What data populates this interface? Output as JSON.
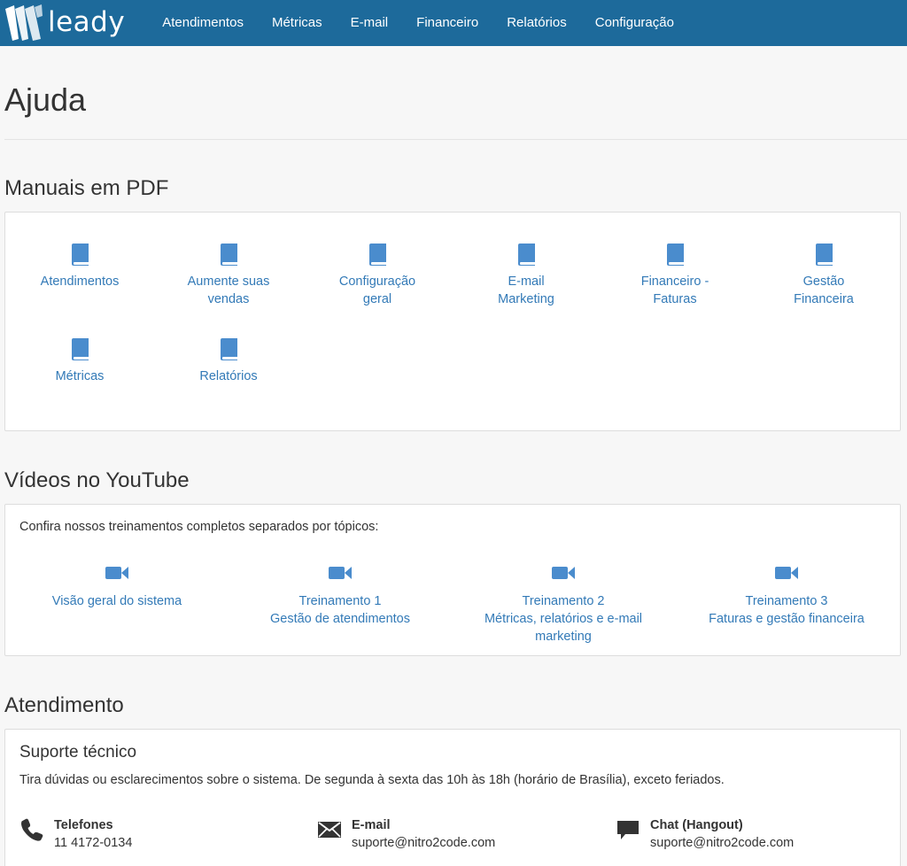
{
  "navbar": {
    "brand": "leady",
    "items": [
      "Atendimentos",
      "Métricas",
      "E-mail",
      "Financeiro",
      "Relatórios",
      "Configuração"
    ]
  },
  "page": {
    "title": "Ajuda"
  },
  "manuals": {
    "title": "Manuais em PDF",
    "items": [
      {
        "line1": "Atendimentos",
        "line2": ""
      },
      {
        "line1": "Aumente suas",
        "line2": "vendas"
      },
      {
        "line1": "Configuração",
        "line2": "geral"
      },
      {
        "line1": "E-mail",
        "line2": "Marketing"
      },
      {
        "line1": "Financeiro -",
        "line2": "Faturas"
      },
      {
        "line1": "Gestão",
        "line2": "Financeira"
      },
      {
        "line1": "Métricas",
        "line2": ""
      },
      {
        "line1": "Relatórios",
        "line2": ""
      }
    ]
  },
  "videos": {
    "title": "Vídeos no YouTube",
    "intro": "Confira nossos treinamentos completos separados por tópicos:",
    "items": [
      {
        "line1": "Visão geral do sistema",
        "line2": "",
        "line3": ""
      },
      {
        "line1": "Treinamento 1",
        "line2": "Gestão de atendimentos",
        "line3": ""
      },
      {
        "line1": "Treinamento 2",
        "line2": "Métricas, relatórios e e-mail",
        "line3": "marketing"
      },
      {
        "line1": "Treinamento 3",
        "line2": "Faturas e gestão financeira",
        "line3": ""
      }
    ]
  },
  "support": {
    "title": "Atendimento",
    "subtitle": "Suporte técnico",
    "description": "Tira dúvidas ou esclarecimentos sobre o sistema. De segunda à sexta das 10h às 18h (horário de Brasília), exceto feriados.",
    "contacts": [
      {
        "label": "Telefones",
        "value": "11 4172-0134",
        "icon": "phone-icon"
      },
      {
        "label": "E-mail",
        "value": "suporte@nitro2code.com",
        "icon": "envelope-icon"
      },
      {
        "label": "Chat (Hangout)",
        "value": "suporte@nitro2code.com",
        "icon": "chat-icon"
      }
    ]
  },
  "colors": {
    "navbar": "#1d6a9b",
    "link": "#337ab7",
    "icon": "#4a8ccd"
  }
}
